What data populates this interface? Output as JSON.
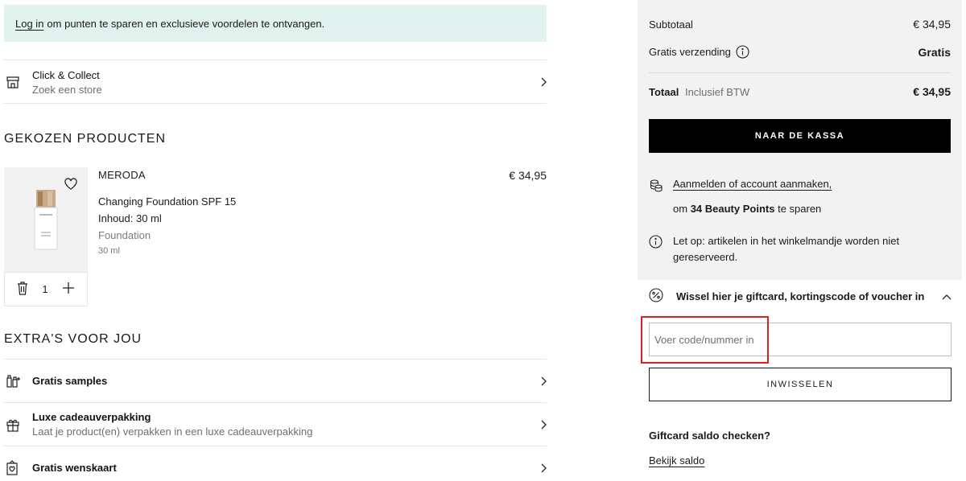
{
  "banner": {
    "login_link": "Log in",
    "text": "om punten te sparen en exclusieve voordelen te ontvangen."
  },
  "click_collect": {
    "title": "Click & Collect",
    "subtitle": "Zoek een store",
    "icon": "store-icon"
  },
  "chosen_products": {
    "heading": "GEKOZEN PRODUCTEN",
    "items": [
      {
        "brand": "MERODA",
        "name": "Changing Foundation SPF 15",
        "content": "Inhoud: 30 ml",
        "category": "Foundation",
        "size": "30 ml",
        "price": "€ 34,95",
        "quantity": "1"
      }
    ]
  },
  "extras": {
    "heading": "EXTRA'S VOOR JOU",
    "items": [
      {
        "title": "Gratis samples",
        "subtitle": "",
        "icon": "samples-icon"
      },
      {
        "title": "Luxe cadeauverpakking",
        "subtitle": "Laat je product(en) verpakken in een luxe cadeauverpakking",
        "icon": "gift-icon"
      },
      {
        "title": "Gratis wenskaart",
        "subtitle": "",
        "icon": "card-icon"
      }
    ]
  },
  "summary": {
    "subtotal_label": "Subtotaal",
    "subtotal_value": "€ 34,95",
    "shipping_label": "Gratis verzending",
    "shipping_value": "Gratis",
    "total_label": "Totaal",
    "total_note": "Inclusief BTW",
    "total_value": "€ 34,95",
    "checkout_label": "NAAR DE KASSA"
  },
  "points": {
    "link": "Aanmelden of account aanmaken,",
    "text_prefix": "om",
    "points_bold": "34 Beauty Points",
    "text_suffix": "te sparen"
  },
  "notice": {
    "text": "Let op: artikelen in het winkelmandje worden niet gereserveerd."
  },
  "voucher": {
    "heading": "Wissel hier je giftcard, kortingscode of voucher in",
    "placeholder": "Voer code/nummer in",
    "redeem_label": "INWISSELEN"
  },
  "giftcard": {
    "title": "Giftcard saldo checken?",
    "link": "Bekijk saldo"
  }
}
